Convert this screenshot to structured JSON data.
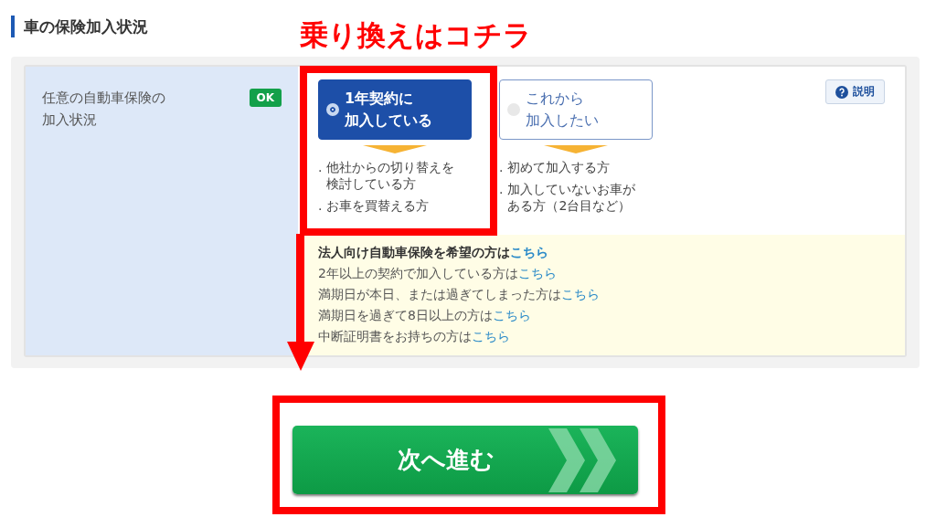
{
  "section_title": "車の保険加入状況",
  "annotation": {
    "title": "乗り換えはコチラ"
  },
  "field": {
    "label_lines": [
      "任意の自動車保険の",
      "加入状況"
    ],
    "status": "OK"
  },
  "options": [
    {
      "label_lines": [
        "1年契約に",
        "加入している"
      ],
      "selected": true,
      "notes": [
        [
          "他社からの切り替えを",
          "検討している方"
        ],
        [
          "お車を買替える方"
        ]
      ]
    },
    {
      "label_lines": [
        "これから",
        "加入したい"
      ],
      "selected": false,
      "notes": [
        [
          "初めて加入する方"
        ],
        [
          "加入していないお車が",
          "ある方（2台目など）"
        ]
      ]
    }
  ],
  "note_bullet": ".",
  "help_button": "説明",
  "links": [
    {
      "text": "法人向け自動車保険を希望の方は",
      "link": "こちら",
      "bold": true
    },
    {
      "text": "2年以上の契約で加入している方は",
      "link": "こちら",
      "bold": false
    },
    {
      "text": "満期日が本日、または過ぎてしまった方は",
      "link": "こちら",
      "bold": false
    },
    {
      "text": "満期日を過ぎて8日以上の方は",
      "link": "こちら",
      "bold": false
    },
    {
      "text": "中断証明書をお持ちの方は",
      "link": "こちら",
      "bold": false
    }
  ],
  "next_button": "次へ進む"
}
